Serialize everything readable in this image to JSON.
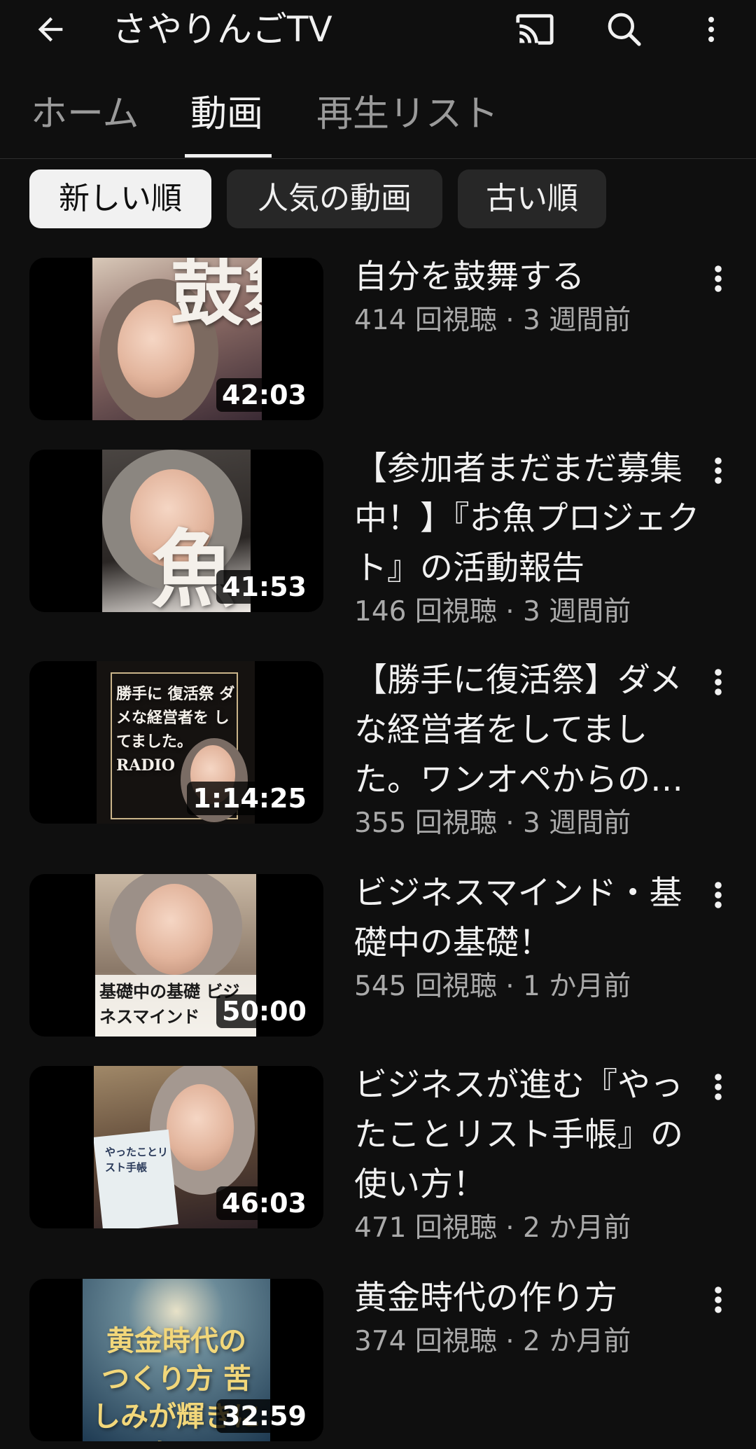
{
  "header": {
    "channel_title": "さやりんごTV",
    "icons": [
      "back-arrow-icon",
      "cast-icon",
      "search-icon",
      "more-vert-icon"
    ]
  },
  "tabs": [
    {
      "label": "ホーム"
    },
    {
      "label": "動画",
      "active": true
    },
    {
      "label": "再生リスト"
    }
  ],
  "chips": [
    {
      "label": "新しい順",
      "selected": true
    },
    {
      "label": "人気の動画"
    },
    {
      "label": "古い順"
    }
  ],
  "videos": [
    {
      "title": "自分を鼓舞する",
      "meta": "414 回視聴 · 3 週間前",
      "duration": "42:03",
      "thumb_text": "鼓舞"
    },
    {
      "title": "【参加者まだまだ募集中！】『お魚プロジェクト』の活動報告",
      "meta": "146 回視聴 · 3 週間前",
      "duration": "41:53",
      "thumb_text": "魚"
    },
    {
      "title": "【勝手に復活祭】ダメな経営者をしてました。ワンオペからの…",
      "meta": "355 回視聴 · 3 週間前",
      "duration": "1:14:25",
      "thumb_text": "勝手に 復活祭 ダメな経営者を してました。 RADIO"
    },
    {
      "title": "ビジネスマインド・基礎中の基礎！",
      "meta": "545 回視聴 · 1 か月前",
      "duration": "50:00",
      "thumb_text": "基礎中の基礎 ビジネスマインド"
    },
    {
      "title": "ビジネスが進む『やったことリスト手帳』の使い方！",
      "meta": "471 回視聴 · 2 か月前",
      "duration": "46:03",
      "thumb_text": "やったことリスト手帳"
    },
    {
      "title": "黄金時代の作り方",
      "meta": "374 回視聴 · 2 か月前",
      "duration": "32:59",
      "thumb_text": "黄金時代の つくり方 苦しみが輝きになる"
    }
  ],
  "colors": {
    "background": "#0f0f0f",
    "text_primary": "#f1f1f1",
    "text_secondary": "#aaaaaa",
    "chip_bg": "#272727",
    "chip_selected_bg": "#f1f1f1"
  }
}
